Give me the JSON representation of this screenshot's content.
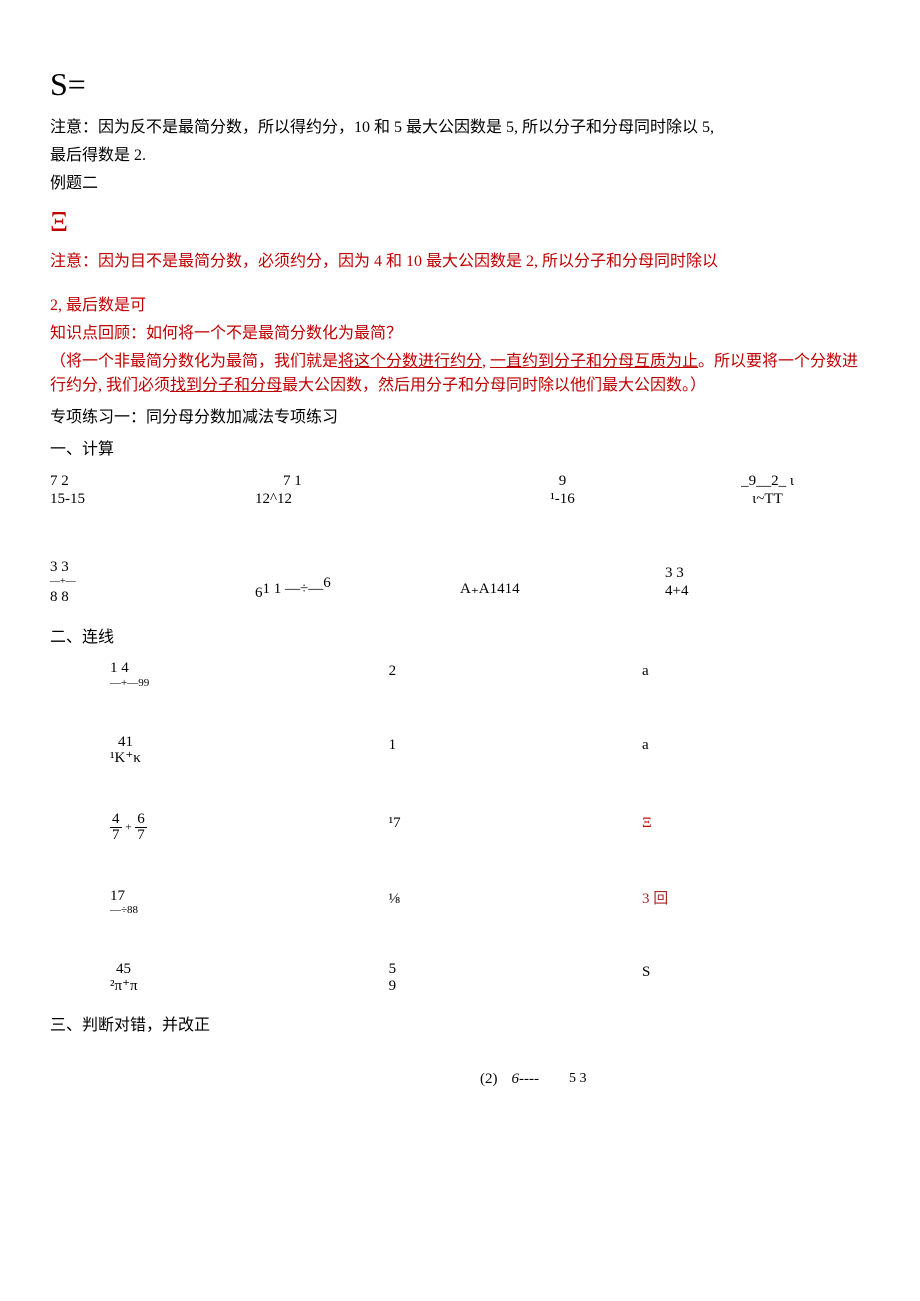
{
  "header": {
    "s_equals": "S="
  },
  "note1": {
    "pre": "注意：因为反不是最简分数，所以得约分，",
    "mid": "10 和 5 最大公因数是 5, 所以分子和分母同时除以 5,",
    "line2": "最后得数是 2.",
    "example_label": "例题二",
    "symbol": "Ξ"
  },
  "note2": {
    "line1_a": "注意：因为目不是最简分数，必须约分，因为 4 和 10 最大公因数是 2, 所以分子和分母同时除以",
    "line2": "2, 最后数是可",
    "review_q": "知识点回顾：如何将一个不是最简分数化为最简？",
    "answer_pre": "（将一个非最简分数化为最简，我们就是",
    "answer_u1": "将这个分数进行约分",
    "answer_mid": ", ",
    "answer_u2": "一直约到分子和分母互质为止",
    "answer_after": "。所以要将一个分数进行约分, 我们必须",
    "answer_u3": "找到分子和分母",
    "answer_end": "最大公因数，然后用分子和分母同时除以他们最大公因数。）"
  },
  "practice1_title": "专项练习一：同分母分数加减法专项练习",
  "section1_title": "一、计算",
  "calc": {
    "r1c1_top": "7     2",
    "r1c1_bot": "15-15",
    "r1c2_top": "7     1",
    "r1c2_bot": "12^12",
    "r1c3_top": "9",
    "r1c3_bot": "¹-16",
    "r1c4_top": "_9__2_ ι",
    "r1c4_bot": "ι~TT",
    "r2c1_top": "3    3",
    "r2c1_mid": "—+—",
    "r2c1_bot": "8    8",
    "r2c2": "1 1 —÷—",
    "r2c2_pre": "6",
    "r2c2_suf": "6",
    "r2c3": "A₊A1414",
    "r2c4_top": "3    3",
    "r2c4_bot": "4+4"
  },
  "section2_title": "二、连线",
  "link": {
    "r1c1_top": "1    4",
    "r1c1_bot": "—+—99",
    "r1c2": "2",
    "r1c3": "a",
    "r2c1_top": "41",
    "r2c1_bot": "¹K⁺κ",
    "r2c2": "1",
    "r2c3": "a",
    "r3c1_n1": "4",
    "r3c1_n2": "6",
    "r3c1_d1": "7",
    "r3c1_d2": "7",
    "r3c1_op": "+",
    "r3c2": "¹7",
    "r3c3": "Ξ",
    "r4c1_top": "17",
    "r4c1_bot": "—÷88",
    "r4c2": "⅛",
    "r4c3": "3 回",
    "r5c1_top": "45",
    "r5c1_bot": "²π⁺π",
    "r5c2_top": "5",
    "r5c2_bot": "9",
    "r5c3": "S"
  },
  "section3_title": "三、判断对错，并改正",
  "problem2": {
    "label": "(2)",
    "expr": "6----",
    "sup": "5    3"
  }
}
